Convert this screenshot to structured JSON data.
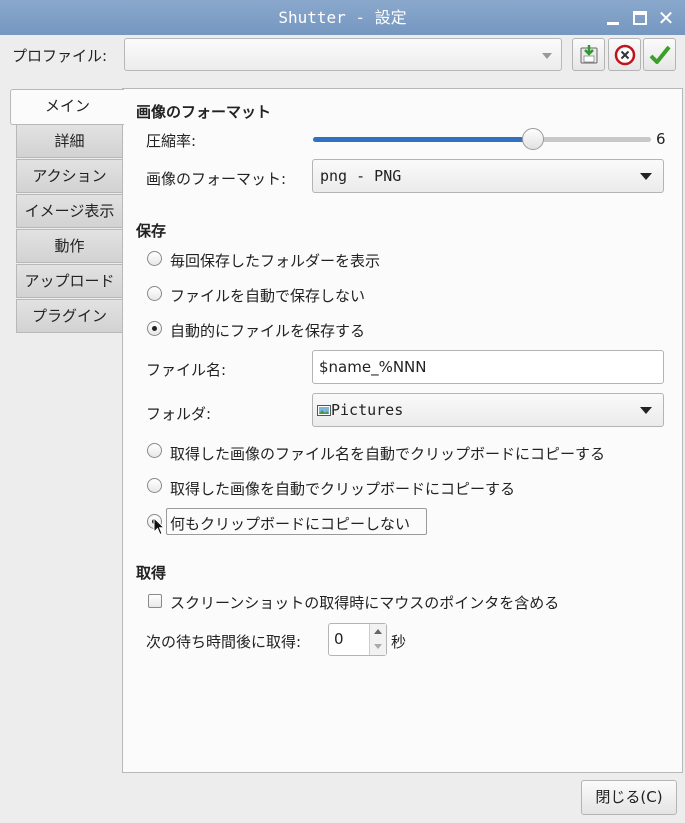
{
  "window": {
    "title": "Shutter - 設定"
  },
  "profile": {
    "label": "プロファイル:",
    "value": ""
  },
  "tabs": [
    "メイン",
    "詳細",
    "アクション",
    "イメージ表示",
    "動作",
    "アップロード",
    "プラグイン"
  ],
  "format_section": {
    "heading": "画像のフォーマット",
    "compression_label": "圧縮率:",
    "compression_value": "6",
    "compression_fraction": 0.65,
    "format_label": "画像のフォーマット:",
    "format_value": "png - PNG"
  },
  "save_section": {
    "heading": "保存",
    "radio_show_folder": "毎回保存したフォルダーを表示",
    "radio_no_autosave": "ファイルを自動で保存しない",
    "radio_autosave": "自動的にファイルを保存する",
    "filename_label": "ファイル名:",
    "filename_value": "$name_%NNN",
    "folder_label": "フォルダ:",
    "folder_value": "Pictures",
    "clip_filename": "取得した画像のファイル名を自動でクリップボードにコピーする",
    "clip_image": "取得した画像を自動でクリップボードにコピーする",
    "clip_none": "何もクリップボードにコピーしない"
  },
  "capture_section": {
    "heading": "取得",
    "include_pointer": "スクリーンショットの取得時にマウスのポインタを含める",
    "delay_label": "次の待ち時間後に取得:",
    "delay_value": "0",
    "delay_unit": "秒"
  },
  "buttons": {
    "close": "閉じる(C)"
  },
  "colors": {
    "accent": "#2f72c4",
    "titlebar": "#7f9fc6"
  }
}
